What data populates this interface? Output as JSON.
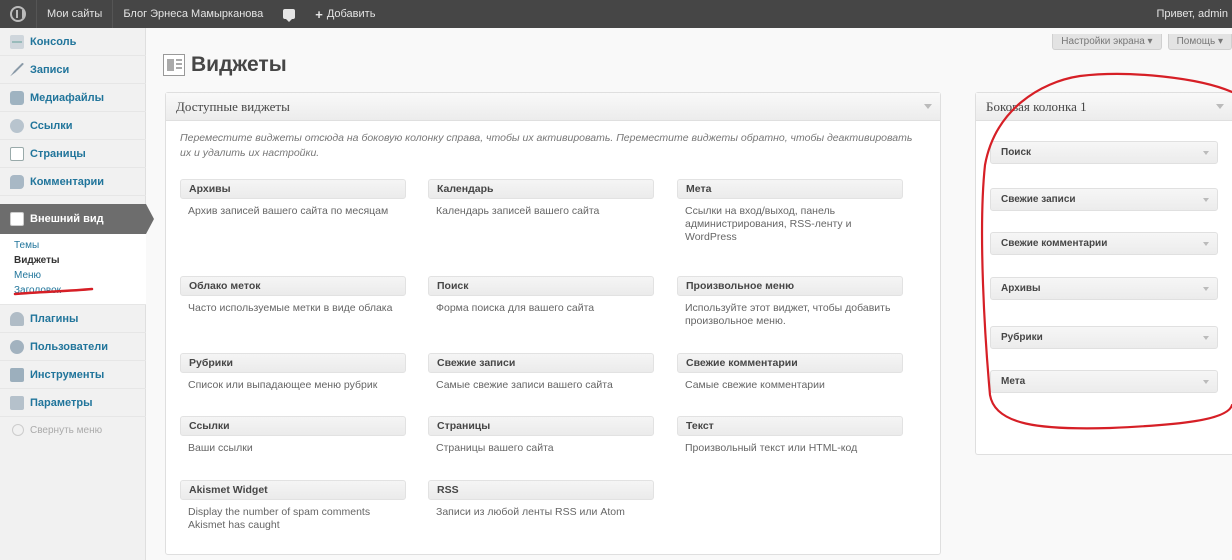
{
  "adminbar": {
    "my_sites": "Мои сайты",
    "blog_name": "Блог Эрнеса Мамырканова",
    "add_new": "Добавить",
    "greeting": "Привет, admin"
  },
  "menu": {
    "dashboard": "Консоль",
    "posts": "Записи",
    "media": "Медиафайлы",
    "links": "Ссылки",
    "pages": "Страницы",
    "comments": "Комментарии",
    "appearance": "Внешний вид",
    "sub": [
      "Темы",
      "Виджеты",
      "Меню",
      "Заголовок"
    ],
    "plugins": "Плагины",
    "users": "Пользователи",
    "tools": "Инструменты",
    "settings": "Параметры",
    "collapse": "Свернуть меню"
  },
  "screen_meta": {
    "screen_options": "Настройки экрана ▾",
    "help": "Помощь ▾"
  },
  "page_title": "Виджеты",
  "available": {
    "title": "Доступные виджеты",
    "description": "Переместите виджеты отсюда на боковую колонку справа, чтобы их активировать. Переместите виджеты обратно, чтобы деактивировать их и удалить их настройки.",
    "widgets": [
      {
        "title": "Архивы",
        "desc": "Архив записей вашего сайта по месяцам"
      },
      {
        "title": "Календарь",
        "desc": "Календарь записей вашего сайта"
      },
      {
        "title": "Мета",
        "desc": "Ссылки на вход/выход, панель администрирования, RSS-ленту и WordPress"
      },
      {
        "title": "Облако меток",
        "desc": "Часто используемые метки в виде облака"
      },
      {
        "title": "Поиск",
        "desc": "Форма поиска для вашего сайта"
      },
      {
        "title": "Произвольное меню",
        "desc": "Используйте этот виджет, чтобы добавить произвольное меню."
      },
      {
        "title": "Рубрики",
        "desc": "Список или выпадающее меню рубрик"
      },
      {
        "title": "Свежие записи",
        "desc": "Самые свежие записи вашего сайта"
      },
      {
        "title": "Свежие комментарии",
        "desc": "Самые свежие комментарии"
      },
      {
        "title": "Ссылки",
        "desc": "Ваши ссылки"
      },
      {
        "title": "Страницы",
        "desc": "Страницы вашего сайта"
      },
      {
        "title": "Текст",
        "desc": "Произвольный текст или HTML-код"
      },
      {
        "title": "Akismet Widget",
        "desc": "Display the number of spam comments Akismet has caught"
      },
      {
        "title": "RSS",
        "desc": "Записи из любой ленты RSS или Atom"
      }
    ]
  },
  "sidebar": {
    "title": "Боковая колонка 1",
    "widgets": [
      "Поиск",
      "Свежие записи",
      "Свежие комментарии",
      "Архивы",
      "Рубрики",
      "Мета"
    ]
  },
  "colors": {
    "adminbar": "#464646",
    "link": "#21759b",
    "current_menu": "#6d6d6d",
    "annotation": "#d61f26"
  }
}
